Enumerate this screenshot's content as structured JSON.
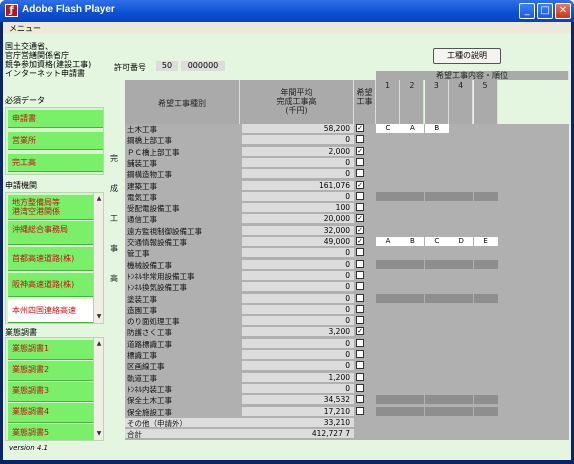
{
  "window": {
    "title": "Adobe Flash Player",
    "menu": "メニュー"
  },
  "applicant": [
    "国土交通省、",
    "官庁営繕関係省庁",
    "競争参加資格(建設工事)",
    "インターネット申請書"
  ],
  "permit": {
    "label": "許可番号",
    "num1": "50",
    "num2": "000000"
  },
  "explain_button": "工種の説明",
  "sections": {
    "required": "必須データ",
    "agencies": "申請機関",
    "surveys": "業態調書"
  },
  "required_items": [
    "申請書",
    "営業所",
    "完工高"
  ],
  "agency_items": [
    "地方整備局等\n港湾空港関係",
    "沖縄総合事務局",
    "首都高速道路(株)",
    "阪神高速道路(株)",
    "本州四国連絡高速"
  ],
  "survey_items": [
    "業態調書1",
    "業態調書2",
    "業態調書3",
    "業態調書4",
    "業態調書5"
  ],
  "version": "version 4.1",
  "table": {
    "col_type": "希望工事種別",
    "col_amount": "年間平均\n完成工事高\n(千円)",
    "col_wish": "希望\n工事",
    "col_rank": "希望工事内容・順位",
    "rank_nums": [
      "1",
      "2",
      "3",
      "4",
      "5"
    ],
    "side_label": "完成工事高"
  },
  "rows": [
    {
      "name": "土木工事",
      "value": "58,200",
      "checked": true,
      "ranks": [
        "C",
        "A",
        "B",
        "",
        ""
      ]
    },
    {
      "name": "鋼橋上部工事",
      "value": "0",
      "checked": false,
      "ranks": []
    },
    {
      "name": "ＰＣ橋上部工事",
      "value": "2,000",
      "checked": true,
      "ranks": []
    },
    {
      "name": "舗装工事",
      "value": "0",
      "checked": false,
      "ranks": []
    },
    {
      "name": "鋼構造物工事",
      "value": "0",
      "checked": false,
      "ranks": []
    },
    {
      "name": "建築工事",
      "value": "161,076",
      "checked": true,
      "ranks": []
    },
    {
      "name": "電気工事",
      "value": "0",
      "checked": false,
      "ranks": [],
      "gray": true
    },
    {
      "name": "受配電設備工事",
      "value": "100",
      "checked": false,
      "ranks": []
    },
    {
      "name": "通信工事",
      "value": "20,000",
      "checked": true,
      "ranks": []
    },
    {
      "name": "遠方監視制御設備工事",
      "value": "32,000",
      "checked": true,
      "ranks": []
    },
    {
      "name": "交通情報設備工事",
      "value": "49,000",
      "checked": true,
      "ranks": [
        "A",
        "B",
        "C",
        "D",
        "E"
      ]
    },
    {
      "name": "管工事",
      "value": "0",
      "checked": false,
      "ranks": []
    },
    {
      "name": "機械設備工事",
      "value": "0",
      "checked": false,
      "ranks": [],
      "gray": true
    },
    {
      "name": "ﾄﾝﾈﾙ非常用設備工事",
      "value": "0",
      "checked": false,
      "ranks": []
    },
    {
      "name": "ﾄﾝﾈﾙ換気設備工事",
      "value": "0",
      "checked": false,
      "ranks": []
    },
    {
      "name": "塗装工事",
      "value": "0",
      "checked": false,
      "ranks": [],
      "gray": true
    },
    {
      "name": "造園工事",
      "value": "0",
      "checked": false,
      "ranks": []
    },
    {
      "name": "のり面処理工事",
      "value": "0",
      "checked": false,
      "ranks": []
    },
    {
      "name": "防護さく工事",
      "value": "3,200",
      "checked": true,
      "ranks": []
    },
    {
      "name": "道路標識工事",
      "value": "0",
      "checked": false,
      "ranks": []
    },
    {
      "name": "標識工事",
      "value": "0",
      "checked": false,
      "ranks": []
    },
    {
      "name": "区画線工事",
      "value": "0",
      "checked": false,
      "ranks": []
    },
    {
      "name": "軌道工事",
      "value": "1,200",
      "checked": false,
      "ranks": []
    },
    {
      "name": "ﾄﾝﾈﾙ内装工事",
      "value": "0",
      "checked": false,
      "ranks": []
    },
    {
      "name": "保全土木工事",
      "value": "34,532",
      "checked": false,
      "ranks": [],
      "gray": true
    },
    {
      "name": "保全施設工事",
      "value": "17,210",
      "checked": false,
      "ranks": [],
      "gray": true
    },
    {
      "name": "その他（申請外）",
      "value": "33,210",
      "checked": null,
      "ranks": []
    },
    {
      "name": "合計",
      "value": "412,727",
      "checked": null,
      "ranks": [],
      "suffix": "7"
    }
  ]
}
